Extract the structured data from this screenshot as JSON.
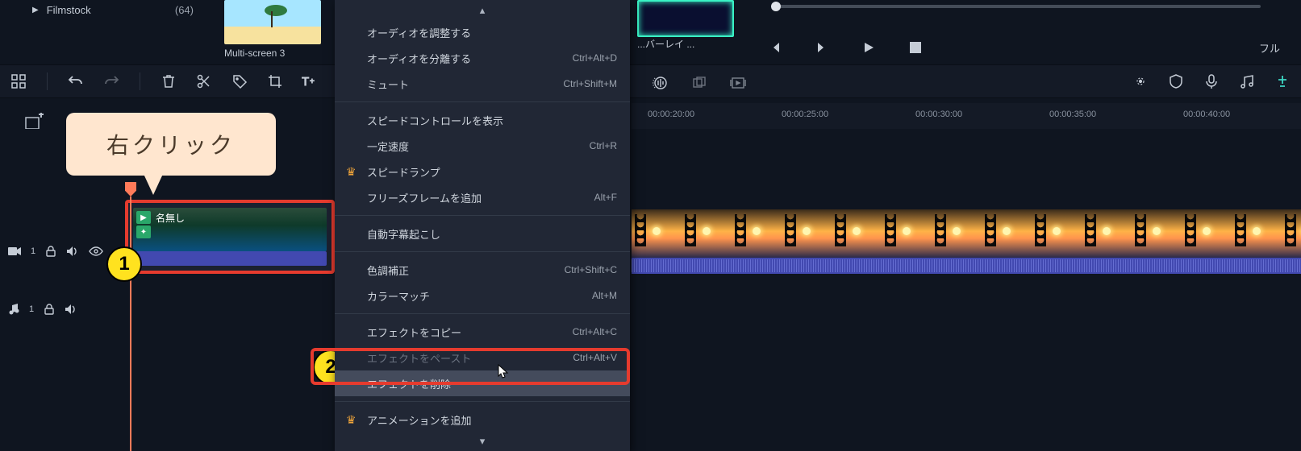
{
  "library": {
    "item": "Filmstock",
    "count": "(64)"
  },
  "thumbs": {
    "t1_label": "Multi-screen 3",
    "t2_label": "...バーレイ ..."
  },
  "transport": {
    "full": "フル"
  },
  "ruler": {
    "t0": "00:00:20:00",
    "t1": "00:00:25:00",
    "t2": "00:00:30:00",
    "t3": "00:00:35:00",
    "t4": "00:00:40:00"
  },
  "tracks": {
    "v1_num": "1",
    "a1_num": "1"
  },
  "clip": {
    "label": "名無し"
  },
  "callout": {
    "text": "右クリック"
  },
  "badge": {
    "n1": "1",
    "n2": "2"
  },
  "menu": {
    "adjust_audio": "オーディオを調整する",
    "detach_audio": "オーディオを分離する",
    "detach_audio_k": "Ctrl+Alt+D",
    "mute": "ミュート",
    "mute_k": "Ctrl+Shift+M",
    "speed_ctl": "スピードコントロールを表示",
    "uniform_speed": "一定速度",
    "uniform_speed_k": "Ctrl+R",
    "speed_ramp": "スピードランプ",
    "freeze": "フリーズフレームを追加",
    "freeze_k": "Alt+F",
    "auto_sub": "自動字幕起こし",
    "color_correct": "色調補正",
    "color_correct_k": "Ctrl+Shift+C",
    "color_match": "カラーマッチ",
    "color_match_k": "Alt+M",
    "copy_fx": "エフェクトをコピー",
    "copy_fx_k": "Ctrl+Alt+C",
    "paste_fx": "エフェクトをペースト",
    "paste_fx_k": "Ctrl+Alt+V",
    "delete_fx": "エフェクトを削除",
    "add_anim": "アニメーションを追加"
  }
}
